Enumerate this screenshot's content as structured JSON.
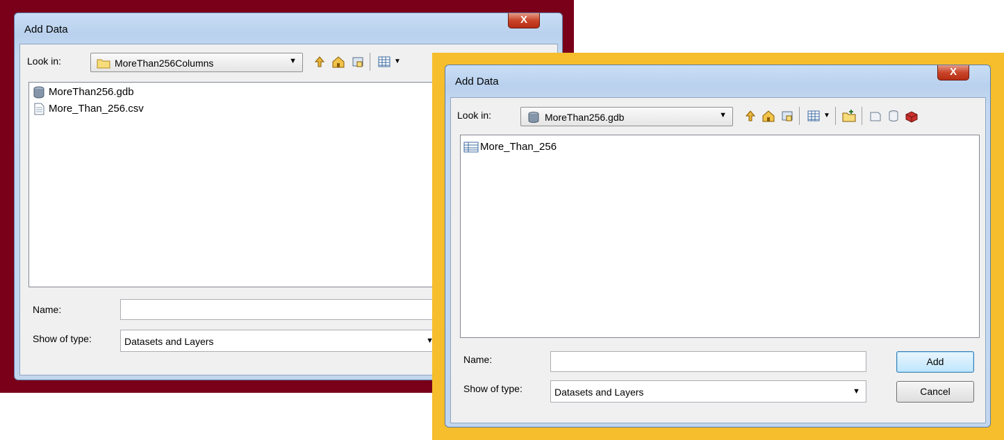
{
  "back_dialog": {
    "title": "Add Data",
    "close_glyph": "X",
    "look_in_label": "Look in:",
    "look_in_value": "MoreThan256Columns",
    "look_in_icon": "folder-icon",
    "files": [
      {
        "name": "MoreThan256.gdb",
        "icon": "geodatabase-icon"
      },
      {
        "name": "More_Than_256.csv",
        "icon": "text-file-icon"
      }
    ],
    "name_label": "Name:",
    "name_value": "",
    "show_of_type_label": "Show of type:",
    "show_of_type_value": "Datasets and Layers"
  },
  "front_dialog": {
    "title": "Add Data",
    "close_glyph": "X",
    "look_in_label": "Look in:",
    "look_in_value": "MoreThan256.gdb",
    "look_in_icon": "geodatabase-icon",
    "files": [
      {
        "name": "More_Than_256",
        "icon": "table-icon"
      }
    ],
    "name_label": "Name:",
    "name_value": "",
    "show_of_type_label": "Show of type:",
    "show_of_type_value": "Datasets and Layers",
    "add_label": "Add",
    "cancel_label": "Cancel"
  },
  "colors": {
    "back_frame": "#7a0019",
    "front_frame": "#f6be2c",
    "close_button": "#c9452a"
  }
}
